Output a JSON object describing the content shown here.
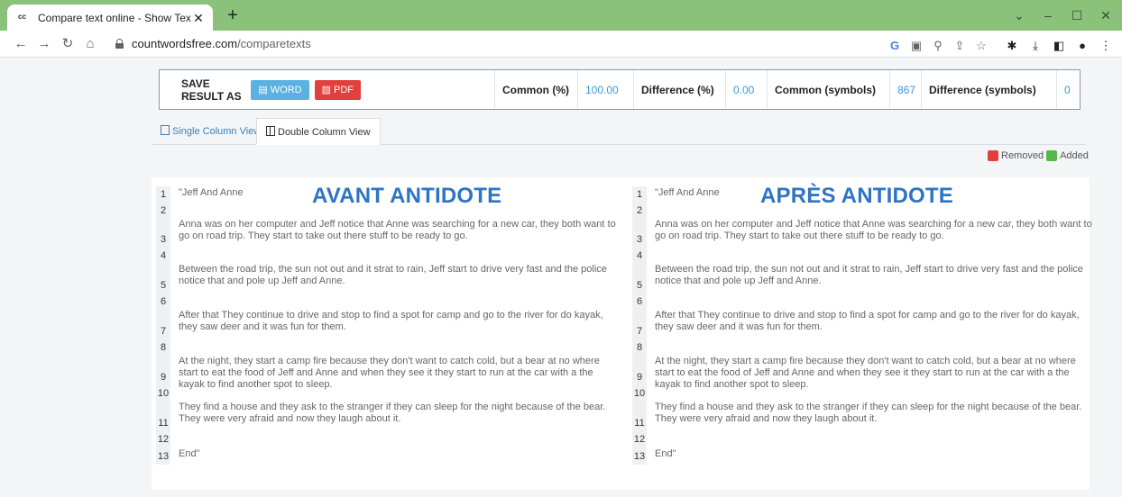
{
  "browser": {
    "tab_title": "Compare text online - Show Text",
    "url_domain": "countwordsfree.com",
    "url_path": "/comparetexts"
  },
  "summary": {
    "save_label": "SAVE RESULT AS",
    "word_label": "WORD",
    "pdf_label": "PDF",
    "common_pct_label": "Common (%)",
    "common_pct_value": "100.00",
    "diff_pct_label": "Difference (%)",
    "diff_pct_value": "0.00",
    "common_sym_label": "Common (symbols)",
    "common_sym_value": "867",
    "diff_sym_label": "Difference (symbols)",
    "diff_sym_value": "0"
  },
  "view_tabs": {
    "single": "Single Column View",
    "double": "Double Column View"
  },
  "legend": {
    "removed": "Removed",
    "added": "Added",
    "removed_color": "#e2403c",
    "added_color": "#54b948"
  },
  "left": {
    "heading": "AVANT ANTIDOTE",
    "lines": [
      "\"Jeff And Anne",
      "",
      "Anna was on her computer and Jeff notice that Anne was searching for a new car, they both want to go on road trip. They start to take out there stuff to be ready to go.",
      "",
      "Between the road trip, the sun not out and it strat to rain, Jeff start to drive very fast and the police notice that and pole up Jeff and Anne.",
      "",
      "After that They continue to drive and stop to find a spot for camp and go to the river for do kayak, they saw deer and it was fun for them.",
      "",
      "At the night, they start a camp fire because they don't want to catch cold, but a bear at no where start to eat the food of Jeff and Anne and when they see it they start to run at the car with a the kayak to find another spot to sleep.",
      "",
      "They find a house and they ask to the stranger if they can sleep for the night because of the bear. They were very afraid and now they laugh about it.",
      "",
      "End\""
    ]
  },
  "right": {
    "heading": "APRÈS ANTIDOTE",
    "lines": [
      "\"Jeff And Anne",
      "",
      "Anna was on her computer and Jeff notice that Anne was searching for a new car, they both want to go on road trip. They start to take out there stuff to be ready to go.",
      "",
      "Between the road trip, the sun not out and it strat to rain, Jeff start to drive very fast and the police notice that and pole up Jeff and Anne.",
      "",
      "After that They continue to drive and stop to find a spot for camp and go to the river for do kayak, they saw deer and it was fun for them.",
      "",
      "At the night, they start a camp fire because they don't want to catch cold, but a bear at no where start to eat the food of Jeff and Anne and when they see it they start to run at the car with a the kayak to find another spot to sleep.",
      "",
      "They find a house and they ask to the stranger if they can sleep for the night because of the bear. They were very afraid and now they laugh about it.",
      "",
      "End\""
    ]
  }
}
